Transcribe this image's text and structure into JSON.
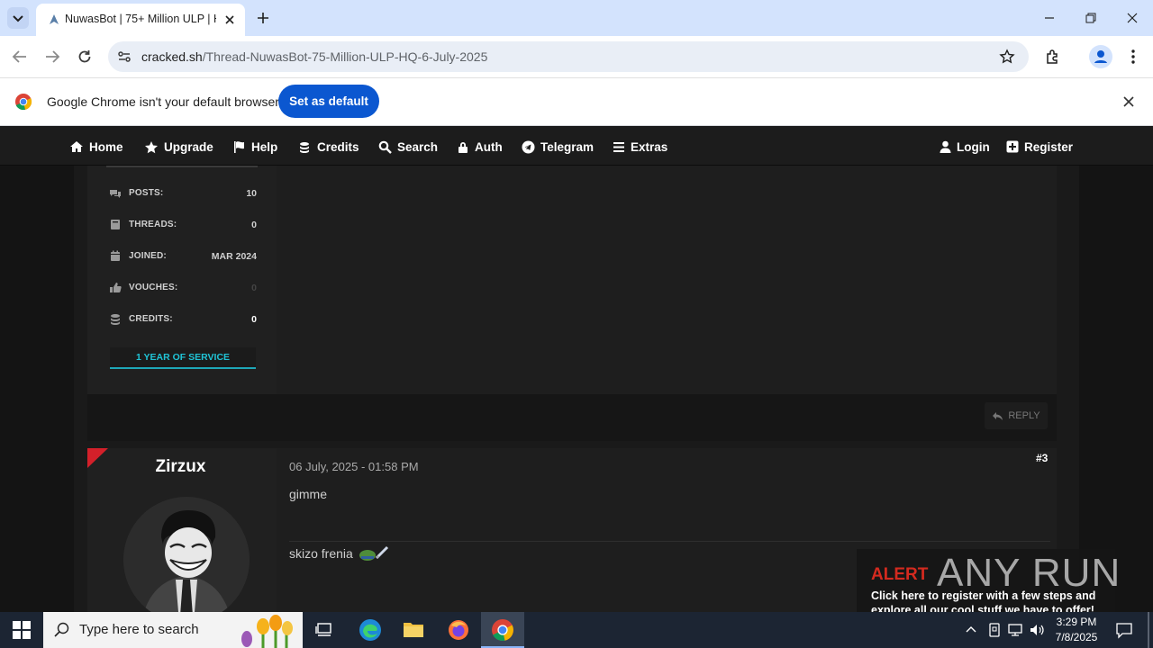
{
  "browser": {
    "tab_title": "NuwasBot | 75+ Million ULP | H",
    "url_host": "cracked.sh",
    "url_path": "/Thread-NuwasBot-75-Million-ULP-HQ-6-July-2025",
    "infobar_text": "Google Chrome isn't your default browser",
    "set_default_label": "Set as default"
  },
  "site_nav": {
    "left": [
      "Home",
      "Upgrade",
      "Help",
      "Credits",
      "Search",
      "Auth",
      "Telegram",
      "Extras"
    ],
    "right": [
      "Login",
      "Register"
    ]
  },
  "post_prev": {
    "stats": [
      {
        "label": "POSTS:",
        "value": "10",
        "icon": "comments-icon"
      },
      {
        "label": "THREADS:",
        "value": "0",
        "icon": "book-icon"
      },
      {
        "label": "JOINED:",
        "value": "MAR 2024",
        "icon": "calendar-icon"
      },
      {
        "label": "VOUCHES:",
        "value": "0",
        "icon": "thumbs-up-icon"
      },
      {
        "label": "CREDITS:",
        "value": "0",
        "icon": "coins-icon"
      }
    ],
    "badge": "1 YEAR OF SERVICE",
    "reply_label": "REPLY"
  },
  "post3": {
    "username": "Zirzux",
    "date": "06 July, 2025 - 01:58 PM",
    "number": "#3",
    "text": "gimme",
    "signature": "skizo frenia"
  },
  "watermark": {
    "alert": "ALERT",
    "brand": "ANY RUN",
    "text": "Click here to register with a few steps and explore all our cool stuff we have to offer!"
  },
  "taskbar": {
    "search_placeholder": "Type here to search",
    "time": "3:29 PM",
    "date": "7/8/2025"
  },
  "colors": {
    "accent": "#0b57d0",
    "service_badge": "#20c4d6",
    "alert_red": "#d42a1f",
    "new_post_flag": "#d4202a"
  }
}
